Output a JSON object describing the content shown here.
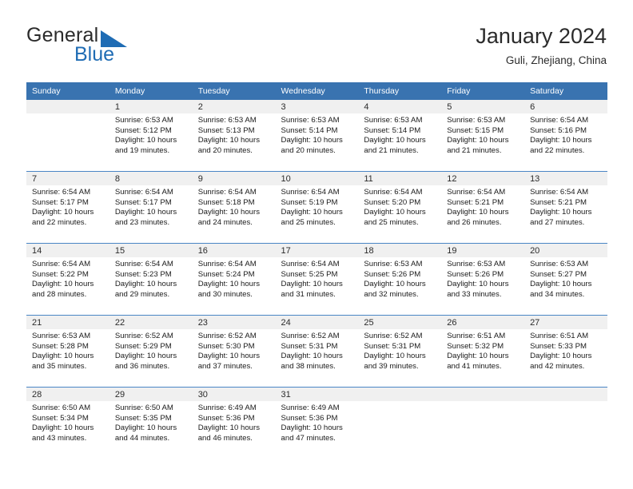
{
  "brand": {
    "name_dark": "General",
    "name_blue": "Blue",
    "accent_color": "#1f6cb4"
  },
  "header": {
    "title": "January 2024",
    "subtitle": "Guli, Zhejiang, China"
  },
  "calendar": {
    "header_bg": "#3973b0",
    "daynum_bg": "#f0f0f0",
    "row_divider": "#4a86c5",
    "weekday_headers": [
      "Sunday",
      "Monday",
      "Tuesday",
      "Wednesday",
      "Thursday",
      "Friday",
      "Saturday"
    ],
    "labels": {
      "sunrise": "Sunrise:",
      "sunset": "Sunset:",
      "daylight": "Daylight:"
    },
    "weeks": [
      [
        {
          "day": "",
          "blank": true
        },
        {
          "day": "1",
          "sunrise": "Sunrise: 6:53 AM",
          "sunset": "Sunset: 5:12 PM",
          "daylight": "Daylight: 10 hours and 19 minutes."
        },
        {
          "day": "2",
          "sunrise": "Sunrise: 6:53 AM",
          "sunset": "Sunset: 5:13 PM",
          "daylight": "Daylight: 10 hours and 20 minutes."
        },
        {
          "day": "3",
          "sunrise": "Sunrise: 6:53 AM",
          "sunset": "Sunset: 5:14 PM",
          "daylight": "Daylight: 10 hours and 20 minutes."
        },
        {
          "day": "4",
          "sunrise": "Sunrise: 6:53 AM",
          "sunset": "Sunset: 5:14 PM",
          "daylight": "Daylight: 10 hours and 21 minutes."
        },
        {
          "day": "5",
          "sunrise": "Sunrise: 6:53 AM",
          "sunset": "Sunset: 5:15 PM",
          "daylight": "Daylight: 10 hours and 21 minutes."
        },
        {
          "day": "6",
          "sunrise": "Sunrise: 6:54 AM",
          "sunset": "Sunset: 5:16 PM",
          "daylight": "Daylight: 10 hours and 22 minutes."
        }
      ],
      [
        {
          "day": "7",
          "sunrise": "Sunrise: 6:54 AM",
          "sunset": "Sunset: 5:17 PM",
          "daylight": "Daylight: 10 hours and 22 minutes."
        },
        {
          "day": "8",
          "sunrise": "Sunrise: 6:54 AM",
          "sunset": "Sunset: 5:17 PM",
          "daylight": "Daylight: 10 hours and 23 minutes."
        },
        {
          "day": "9",
          "sunrise": "Sunrise: 6:54 AM",
          "sunset": "Sunset: 5:18 PM",
          "daylight": "Daylight: 10 hours and 24 minutes."
        },
        {
          "day": "10",
          "sunrise": "Sunrise: 6:54 AM",
          "sunset": "Sunset: 5:19 PM",
          "daylight": "Daylight: 10 hours and 25 minutes."
        },
        {
          "day": "11",
          "sunrise": "Sunrise: 6:54 AM",
          "sunset": "Sunset: 5:20 PM",
          "daylight": "Daylight: 10 hours and 25 minutes."
        },
        {
          "day": "12",
          "sunrise": "Sunrise: 6:54 AM",
          "sunset": "Sunset: 5:21 PM",
          "daylight": "Daylight: 10 hours and 26 minutes."
        },
        {
          "day": "13",
          "sunrise": "Sunrise: 6:54 AM",
          "sunset": "Sunset: 5:21 PM",
          "daylight": "Daylight: 10 hours and 27 minutes."
        }
      ],
      [
        {
          "day": "14",
          "sunrise": "Sunrise: 6:54 AM",
          "sunset": "Sunset: 5:22 PM",
          "daylight": "Daylight: 10 hours and 28 minutes."
        },
        {
          "day": "15",
          "sunrise": "Sunrise: 6:54 AM",
          "sunset": "Sunset: 5:23 PM",
          "daylight": "Daylight: 10 hours and 29 minutes."
        },
        {
          "day": "16",
          "sunrise": "Sunrise: 6:54 AM",
          "sunset": "Sunset: 5:24 PM",
          "daylight": "Daylight: 10 hours and 30 minutes."
        },
        {
          "day": "17",
          "sunrise": "Sunrise: 6:54 AM",
          "sunset": "Sunset: 5:25 PM",
          "daylight": "Daylight: 10 hours and 31 minutes."
        },
        {
          "day": "18",
          "sunrise": "Sunrise: 6:53 AM",
          "sunset": "Sunset: 5:26 PM",
          "daylight": "Daylight: 10 hours and 32 minutes."
        },
        {
          "day": "19",
          "sunrise": "Sunrise: 6:53 AM",
          "sunset": "Sunset: 5:26 PM",
          "daylight": "Daylight: 10 hours and 33 minutes."
        },
        {
          "day": "20",
          "sunrise": "Sunrise: 6:53 AM",
          "sunset": "Sunset: 5:27 PM",
          "daylight": "Daylight: 10 hours and 34 minutes."
        }
      ],
      [
        {
          "day": "21",
          "sunrise": "Sunrise: 6:53 AM",
          "sunset": "Sunset: 5:28 PM",
          "daylight": "Daylight: 10 hours and 35 minutes."
        },
        {
          "day": "22",
          "sunrise": "Sunrise: 6:52 AM",
          "sunset": "Sunset: 5:29 PM",
          "daylight": "Daylight: 10 hours and 36 minutes."
        },
        {
          "day": "23",
          "sunrise": "Sunrise: 6:52 AM",
          "sunset": "Sunset: 5:30 PM",
          "daylight": "Daylight: 10 hours and 37 minutes."
        },
        {
          "day": "24",
          "sunrise": "Sunrise: 6:52 AM",
          "sunset": "Sunset: 5:31 PM",
          "daylight": "Daylight: 10 hours and 38 minutes."
        },
        {
          "day": "25",
          "sunrise": "Sunrise: 6:52 AM",
          "sunset": "Sunset: 5:31 PM",
          "daylight": "Daylight: 10 hours and 39 minutes."
        },
        {
          "day": "26",
          "sunrise": "Sunrise: 6:51 AM",
          "sunset": "Sunset: 5:32 PM",
          "daylight": "Daylight: 10 hours and 41 minutes."
        },
        {
          "day": "27",
          "sunrise": "Sunrise: 6:51 AM",
          "sunset": "Sunset: 5:33 PM",
          "daylight": "Daylight: 10 hours and 42 minutes."
        }
      ],
      [
        {
          "day": "28",
          "sunrise": "Sunrise: 6:50 AM",
          "sunset": "Sunset: 5:34 PM",
          "daylight": "Daylight: 10 hours and 43 minutes."
        },
        {
          "day": "29",
          "sunrise": "Sunrise: 6:50 AM",
          "sunset": "Sunset: 5:35 PM",
          "daylight": "Daylight: 10 hours and 44 minutes."
        },
        {
          "day": "30",
          "sunrise": "Sunrise: 6:49 AM",
          "sunset": "Sunset: 5:36 PM",
          "daylight": "Daylight: 10 hours and 46 minutes."
        },
        {
          "day": "31",
          "sunrise": "Sunrise: 6:49 AM",
          "sunset": "Sunset: 5:36 PM",
          "daylight": "Daylight: 10 hours and 47 minutes."
        },
        {
          "day": "",
          "blank": true
        },
        {
          "day": "",
          "blank": true
        },
        {
          "day": "",
          "blank": true
        }
      ]
    ]
  }
}
